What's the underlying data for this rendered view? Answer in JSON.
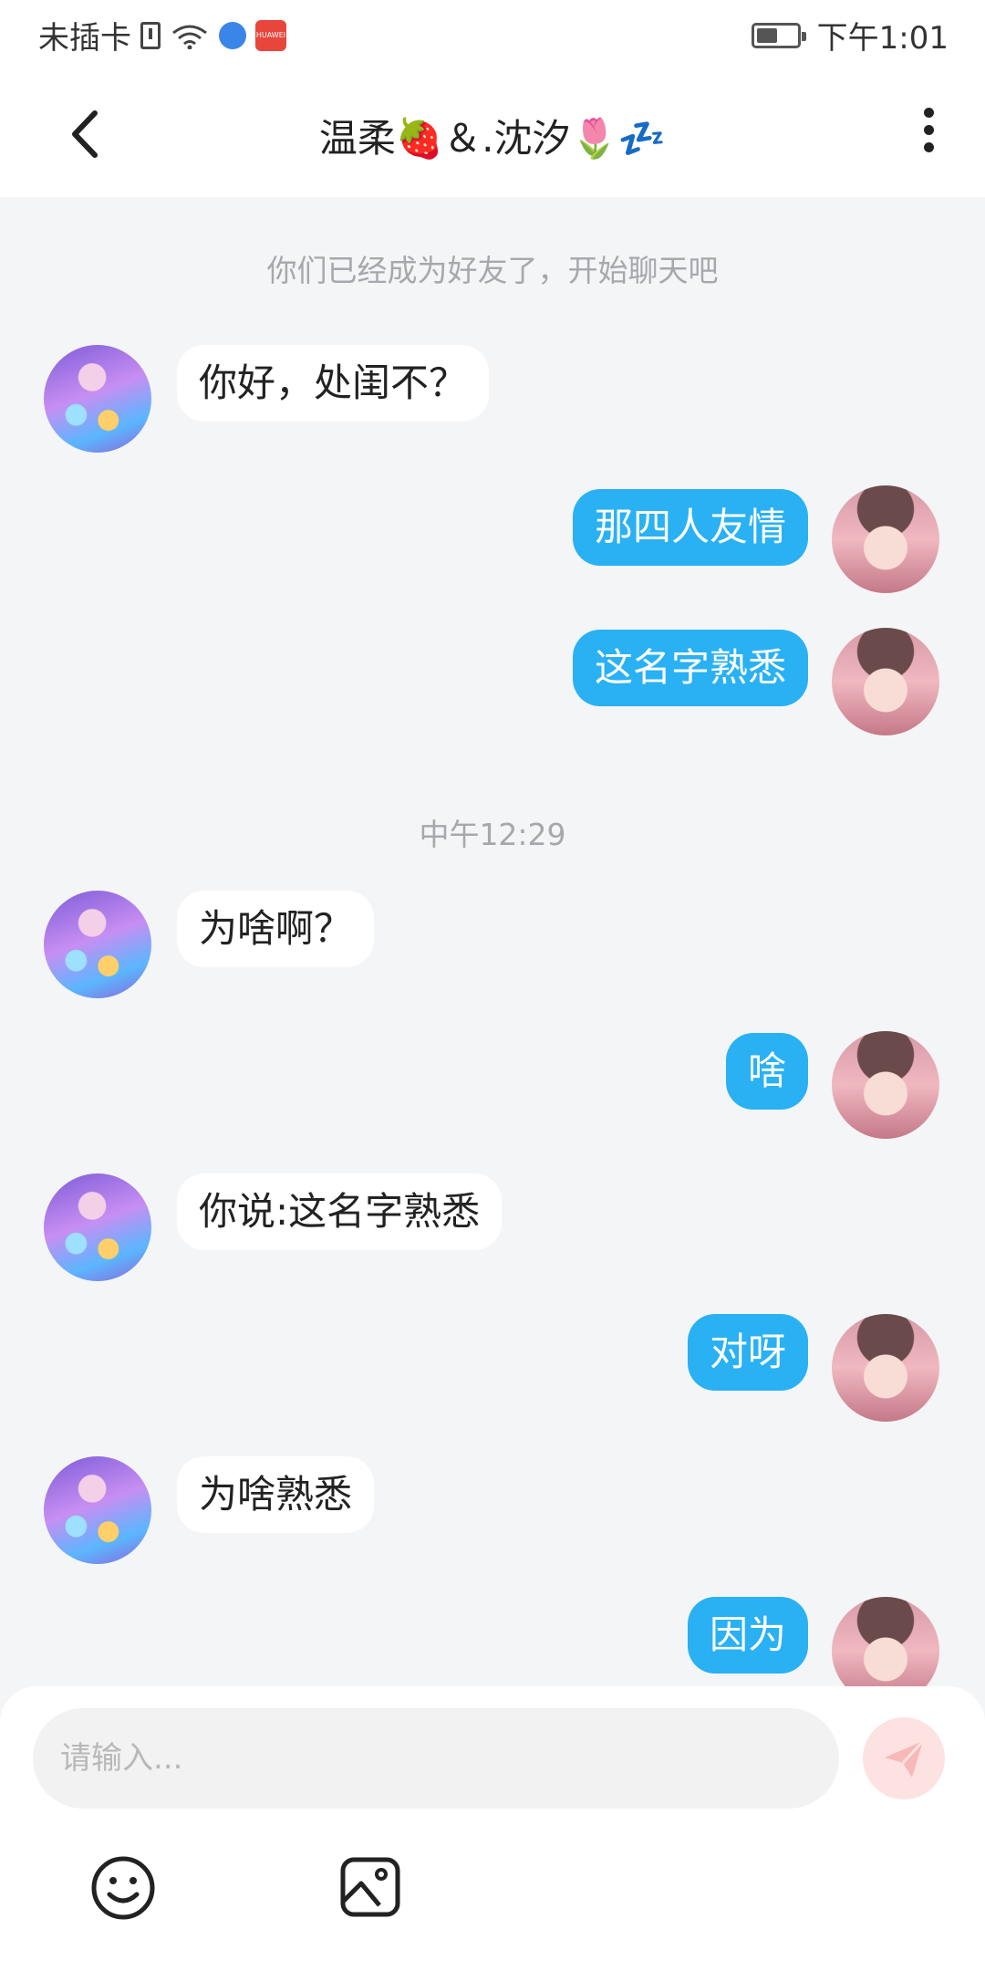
{
  "status_bar": {
    "carrier": "未插卡",
    "badge": "HUAWEI",
    "time": "下午1:01"
  },
  "header": {
    "title": "温柔🍓＆.沈汐🌷💤"
  },
  "chat": {
    "system_note": "你们已经成为好友了，开始聊天吧",
    "timestamp": "中午12:29",
    "messages": [
      {
        "side": "friend",
        "text": "你好，处闺不？"
      },
      {
        "side": "me",
        "text": "那四人友情"
      },
      {
        "side": "me",
        "text": "这名字熟悉"
      },
      {
        "side": "friend",
        "text": "为啥啊？"
      },
      {
        "side": "me",
        "text": "啥"
      },
      {
        "side": "friend",
        "text": "你说:这名字熟悉"
      },
      {
        "side": "me",
        "text": "对呀"
      },
      {
        "side": "friend",
        "text": "为啥熟悉"
      },
      {
        "side": "me",
        "text": "因为"
      }
    ]
  },
  "composer": {
    "placeholder": "请输入..."
  },
  "icons": {
    "back": "chevron-left-icon",
    "more": "more-vertical-icon",
    "send": "send-icon",
    "emoji": "smiley-icon",
    "image": "image-icon"
  },
  "colors": {
    "my_bubble": "#29b1f3",
    "friend_bubble": "#ffffff",
    "background": "#f4f5f7",
    "send_disabled": "#fde2e2"
  }
}
